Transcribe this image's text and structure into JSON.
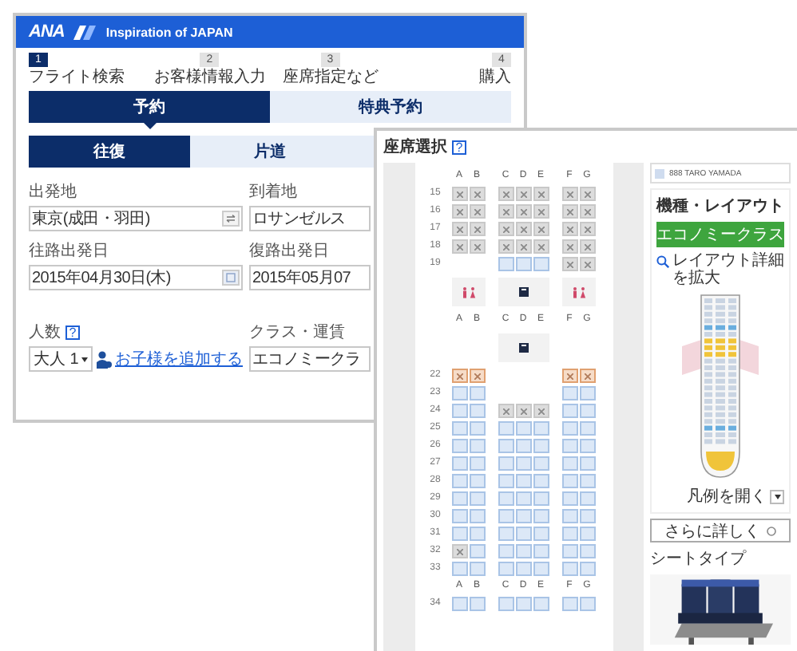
{
  "booking_window": {
    "logo": "ANA",
    "title": "Inspiration of JAPAN",
    "steps": [
      {
        "number": "1",
        "label": "フライト検索",
        "selected": true
      },
      {
        "number": "2",
        "label": "お客様情報入力",
        "selected": false
      },
      {
        "number": "3",
        "label": "座席指定など",
        "selected": false
      },
      {
        "number": "4",
        "label": "購入",
        "selected": false
      }
    ],
    "tabs": [
      {
        "label": "予約",
        "selected": true
      },
      {
        "label": "特典予約",
        "selected": false
      }
    ],
    "trip_tabs": [
      {
        "label": "往復",
        "selected": true
      },
      {
        "label": "片道",
        "selected": false
      }
    ],
    "field_rows": [
      [
        {
          "label": "出発地",
          "value": "東京(成田・羽田)",
          "kind": "swap"
        },
        {
          "label": "到着地",
          "value": "ロサンゼルス",
          "kind": "text"
        }
      ],
      [
        {
          "label": "往路出発日",
          "value": "2015年04月30日(木)",
          "kind": "date"
        },
        {
          "label": "復路出発日",
          "value": "2015年05月07",
          "kind": "text"
        }
      ]
    ],
    "passengers": {
      "label": "人数",
      "help": "?",
      "value": "大人 1",
      "link": "お子様を追加する"
    },
    "cabin_class": {
      "label": "クラス・運賃",
      "value": "エコノミークラ"
    }
  },
  "seat_window": {
    "title": "座席選択",
    "help": "?",
    "seat_map": {
      "rows": [
        {
          "kind": "letters",
          "letters": [
            "A",
            "B",
            "C",
            "D",
            "E",
            "F",
            "G"
          ]
        },
        {
          "kind": "seats",
          "number": "15",
          "seats": [
            {
              "kind": "standard",
              "occupied": true
            },
            {
              "kind": "standard",
              "occupied": true
            },
            {
              "kind": "standard",
              "occupied": true
            },
            {
              "kind": "standard",
              "occupied": true
            },
            {
              "kind": "standard",
              "occupied": true
            },
            {
              "kind": "standard",
              "occupied": true
            },
            {
              "kind": "standard",
              "occupied": true
            }
          ]
        },
        {
          "kind": "seats",
          "number": "16",
          "seats": [
            {
              "kind": "standard",
              "occupied": true
            },
            {
              "kind": "standard",
              "occupied": true
            },
            {
              "kind": "standard",
              "occupied": true
            },
            {
              "kind": "standard",
              "occupied": true
            },
            {
              "kind": "standard",
              "occupied": true
            },
            {
              "kind": "standard",
              "occupied": true
            },
            {
              "kind": "standard",
              "occupied": true
            }
          ]
        },
        {
          "kind": "seats",
          "number": "17",
          "seats": [
            {
              "kind": "standard",
              "occupied": true
            },
            {
              "kind": "standard",
              "occupied": true
            },
            {
              "kind": "standard",
              "occupied": true
            },
            {
              "kind": "standard",
              "occupied": true
            },
            {
              "kind": "standard",
              "occupied": true
            },
            {
              "kind": "standard",
              "occupied": true
            },
            {
              "kind": "standard",
              "occupied": true
            }
          ]
        },
        {
          "kind": "seats",
          "number": "18",
          "seats": [
            {
              "kind": "standard",
              "occupied": true
            },
            {
              "kind": "standard",
              "occupied": true
            },
            {
              "kind": "standard",
              "occupied": true
            },
            {
              "kind": "standard",
              "occupied": true
            },
            {
              "kind": "standard",
              "occupied": true
            },
            {
              "kind": "standard",
              "occupied": true
            },
            {
              "kind": "standard",
              "occupied": true
            }
          ]
        },
        {
          "kind": "seats",
          "number": "19",
          "seats": [
            {
              "kind": "gap"
            },
            {
              "kind": "gap"
            },
            {
              "kind": "standard",
              "occupied": false
            },
            {
              "kind": "standard",
              "occupied": false
            },
            {
              "kind": "standard",
              "occupied": false
            },
            {
              "kind": "standard",
              "occupied": true
            },
            {
              "kind": "standard",
              "occupied": true
            }
          ]
        },
        {
          "kind": "facility",
          "blocks": [
            {
              "kind": "lavatory"
            },
            {
              "kind": "galley"
            },
            {
              "kind": "lavatory"
            }
          ]
        },
        {
          "kind": "letters",
          "letters": [
            "A",
            "B",
            "C",
            "D",
            "E",
            "F",
            "G"
          ]
        },
        {
          "kind": "facility",
          "blocks": [
            {
              "kind": "none"
            },
            {
              "kind": "galley"
            },
            {
              "kind": "none"
            }
          ]
        },
        {
          "kind": "seats",
          "number": "22",
          "seats": [
            {
              "kind": "exit",
              "occupied": true
            },
            {
              "kind": "exit",
              "occupied": true
            },
            {
              "kind": "gap"
            },
            {
              "kind": "gap"
            },
            {
              "kind": "gap"
            },
            {
              "kind": "exit",
              "occupied": true
            },
            {
              "kind": "exit",
              "occupied": true
            }
          ]
        },
        {
          "kind": "seats",
          "number": "23",
          "seats": [
            {
              "kind": "standard",
              "occupied": false
            },
            {
              "kind": "standard",
              "occupied": false
            },
            {
              "kind": "gap"
            },
            {
              "kind": "gap"
            },
            {
              "kind": "gap"
            },
            {
              "kind": "standard",
              "occupied": false
            },
            {
              "kind": "standard",
              "occupied": false
            }
          ]
        },
        {
          "kind": "seats",
          "number": "24",
          "seats": [
            {
              "kind": "standard",
              "occupied": false
            },
            {
              "kind": "standard",
              "occupied": false
            },
            {
              "kind": "standard",
              "occupied": true
            },
            {
              "kind": "standard",
              "occupied": true
            },
            {
              "kind": "standard",
              "occupied": true
            },
            {
              "kind": "standard",
              "occupied": false
            },
            {
              "kind": "standard",
              "occupied": false
            }
          ]
        },
        {
          "kind": "seats",
          "number": "25",
          "seats": [
            {
              "kind": "standard",
              "occupied": false
            },
            {
              "kind": "standard",
              "occupied": false
            },
            {
              "kind": "standard",
              "occupied": false
            },
            {
              "kind": "standard",
              "occupied": false
            },
            {
              "kind": "standard",
              "occupied": false
            },
            {
              "kind": "standard",
              "occupied": false
            },
            {
              "kind": "standard",
              "occupied": false
            }
          ]
        },
        {
          "kind": "seats",
          "number": "26",
          "seats": [
            {
              "kind": "standard",
              "occupied": false
            },
            {
              "kind": "standard",
              "occupied": false
            },
            {
              "kind": "standard",
              "occupied": false
            },
            {
              "kind": "standard",
              "occupied": false
            },
            {
              "kind": "standard",
              "occupied": false
            },
            {
              "kind": "standard",
              "occupied": false
            },
            {
              "kind": "standard",
              "occupied": false
            }
          ]
        },
        {
          "kind": "seats",
          "number": "27",
          "seats": [
            {
              "kind": "standard",
              "occupied": false
            },
            {
              "kind": "standard",
              "occupied": false
            },
            {
              "kind": "standard",
              "occupied": false
            },
            {
              "kind": "standard",
              "occupied": false
            },
            {
              "kind": "standard",
              "occupied": false
            },
            {
              "kind": "standard",
              "occupied": false
            },
            {
              "kind": "standard",
              "occupied": false
            }
          ]
        },
        {
          "kind": "seats",
          "number": "28",
          "seats": [
            {
              "kind": "standard",
              "occupied": false
            },
            {
              "kind": "standard",
              "occupied": false
            },
            {
              "kind": "standard",
              "occupied": false
            },
            {
              "kind": "standard",
              "occupied": false
            },
            {
              "kind": "standard",
              "occupied": false
            },
            {
              "kind": "standard",
              "occupied": false
            },
            {
              "kind": "standard",
              "occupied": false
            }
          ]
        },
        {
          "kind": "seats",
          "number": "29",
          "seats": [
            {
              "kind": "standard",
              "occupied": false
            },
            {
              "kind": "standard",
              "occupied": false
            },
            {
              "kind": "standard",
              "occupied": false
            },
            {
              "kind": "standard",
              "occupied": false
            },
            {
              "kind": "standard",
              "occupied": false
            },
            {
              "kind": "standard",
              "occupied": false
            },
            {
              "kind": "standard",
              "occupied": false
            }
          ]
        },
        {
          "kind": "seats",
          "number": "30",
          "seats": [
            {
              "kind": "standard",
              "occupied": false
            },
            {
              "kind": "standard",
              "occupied": false
            },
            {
              "kind": "standard",
              "occupied": false
            },
            {
              "kind": "standard",
              "occupied": false
            },
            {
              "kind": "standard",
              "occupied": false
            },
            {
              "kind": "standard",
              "occupied": false
            },
            {
              "kind": "standard",
              "occupied": false
            }
          ]
        },
        {
          "kind": "seats",
          "number": "31",
          "seats": [
            {
              "kind": "standard",
              "occupied": false
            },
            {
              "kind": "standard",
              "occupied": false
            },
            {
              "kind": "standard",
              "occupied": false
            },
            {
              "kind": "standard",
              "occupied": false
            },
            {
              "kind": "standard",
              "occupied": false
            },
            {
              "kind": "standard",
              "occupied": false
            },
            {
              "kind": "standard",
              "occupied": false
            }
          ]
        },
        {
          "kind": "seats",
          "number": "32",
          "seats": [
            {
              "kind": "standard",
              "occupied": true
            },
            {
              "kind": "standard",
              "occupied": false
            },
            {
              "kind": "standard",
              "occupied": false
            },
            {
              "kind": "standard",
              "occupied": false
            },
            {
              "kind": "standard",
              "occupied": false
            },
            {
              "kind": "standard",
              "occupied": false
            },
            {
              "kind": "standard",
              "occupied": false
            }
          ]
        },
        {
          "kind": "seats",
          "number": "33",
          "seats": [
            {
              "kind": "standard",
              "occupied": false
            },
            {
              "kind": "standard",
              "occupied": false
            },
            {
              "kind": "standard",
              "occupied": false
            },
            {
              "kind": "standard",
              "occupied": false
            },
            {
              "kind": "standard",
              "occupied": false
            },
            {
              "kind": "standard",
              "occupied": false
            },
            {
              "kind": "standard",
              "occupied": false
            }
          ]
        },
        {
          "kind": "letters",
          "letters": [
            "A",
            "B",
            "C",
            "D",
            "E",
            "F",
            "G"
          ]
        },
        {
          "kind": "seats",
          "number": "34",
          "seats": [
            {
              "kind": "standard",
              "occupied": false
            },
            {
              "kind": "standard",
              "occupied": false
            },
            {
              "kind": "standard",
              "occupied": false
            },
            {
              "kind": "standard",
              "occupied": false
            },
            {
              "kind": "standard",
              "occupied": false
            },
            {
              "kind": "standard",
              "occupied": false
            },
            {
              "kind": "standard",
              "occupied": false
            }
          ]
        }
      ]
    },
    "passenger": "888 TARO YAMADA",
    "layout_heading": "機種・レイアウト",
    "cabin": "エコノミークラス",
    "zoom_link": "レイアウト詳細を拡大",
    "legend": "凡例を開く",
    "more_button": "さらに詳しく",
    "seat_type": "シートタイプ"
  }
}
